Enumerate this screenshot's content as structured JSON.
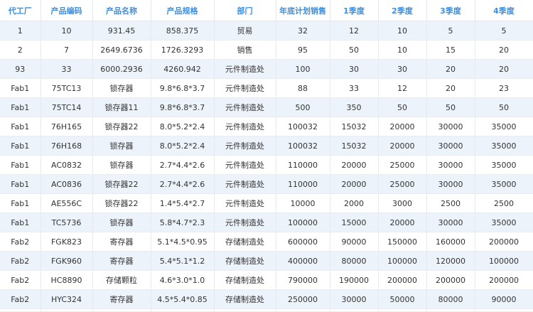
{
  "table": {
    "headers": [
      "代工厂",
      "产品编码",
      "产品名称",
      "产品规格",
      "部门",
      "年底计划销售",
      "1季度",
      "2季度",
      "3季度",
      "4季度"
    ],
    "rows": [
      [
        "1",
        "10",
        "931.45",
        "858.375",
        "贸易",
        "32",
        "12",
        "10",
        "5",
        "5"
      ],
      [
        "2",
        "7",
        "2649.6736",
        "1726.3293",
        "销售",
        "95",
        "50",
        "10",
        "15",
        "20"
      ],
      [
        "93",
        "33",
        "6000.2936",
        "4260.942",
        "元件制造处",
        "100",
        "30",
        "30",
        "20",
        "20"
      ],
      [
        "Fab1",
        "75TC13",
        "锁存器",
        "9.8*6.8*3.7",
        "元件制造处",
        "88",
        "33",
        "12",
        "20",
        "23"
      ],
      [
        "Fab1",
        "75TC14",
        "锁存器11",
        "9.8*6.8*3.7",
        "元件制造处",
        "500",
        "350",
        "50",
        "50",
        "50"
      ],
      [
        "Fab1",
        "76H165",
        "锁存器22",
        "8.0*5.2*2.4",
        "元件制造处",
        "100032",
        "15032",
        "20000",
        "30000",
        "35000"
      ],
      [
        "Fab1",
        "76H168",
        "锁存器",
        "8.0*5.2*2.4",
        "元件制造处",
        "100032",
        "15032",
        "20000",
        "30000",
        "35000"
      ],
      [
        "Fab1",
        "AC0832",
        "锁存器",
        "2.7*4.4*2.6",
        "元件制造处",
        "110000",
        "20000",
        "25000",
        "30000",
        "35000"
      ],
      [
        "Fab1",
        "AC0836",
        "锁存器22",
        "2.7*4.4*2.6",
        "元件制造处",
        "110000",
        "20000",
        "25000",
        "30000",
        "35000"
      ],
      [
        "Fab1",
        "AE556C",
        "锁存器22",
        "1.4*5.4*2.7",
        "元件制造处",
        "10000",
        "2000",
        "3000",
        "2500",
        "2500"
      ],
      [
        "Fab1",
        "TC5736",
        "锁存器",
        "5.8*4.7*2.3",
        "元件制造处",
        "100000",
        "15000",
        "20000",
        "30000",
        "35000"
      ],
      [
        "Fab2",
        "FGK823",
        "寄存器",
        "5.1*4.5*0.95",
        "存储制造处",
        "600000",
        "90000",
        "150000",
        "160000",
        "200000"
      ],
      [
        "Fab2",
        "FGK960",
        "寄存器",
        "5.4*5.1*1.2",
        "存储制造处",
        "400000",
        "80000",
        "100000",
        "120000",
        "100000"
      ],
      [
        "Fab2",
        "HC8890",
        "存储颗粒",
        "4.6*3.0*1.0",
        "存储制造处",
        "790000",
        "190000",
        "200000",
        "200000",
        "200000"
      ],
      [
        "Fab2",
        "HYC324",
        "寄存器",
        "4.5*5.4*0.85",
        "存储制造处",
        "250000",
        "30000",
        "50000",
        "80000",
        "90000"
      ]
    ]
  }
}
